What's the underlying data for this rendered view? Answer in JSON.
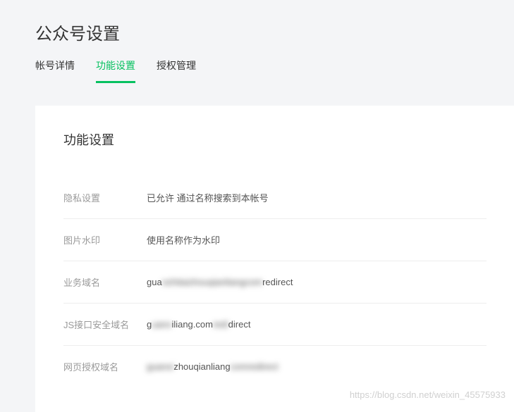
{
  "pageTitle": "公众号设置",
  "tabs": [
    {
      "label": "帐号详情",
      "active": false
    },
    {
      "label": "功能设置",
      "active": true
    },
    {
      "label": "授权管理",
      "active": false
    }
  ],
  "card": {
    "title": "功能设置",
    "rows": {
      "privacy": {
        "label": "隐私设置",
        "value": "已允许 通过名称搜索到本帐号"
      },
      "watermark": {
        "label": "图片水印",
        "value": "使用名称作为水印"
      },
      "businessDomain": {
        "label": "业务域名",
        "valuePrefix": "gua",
        "valueBlurred": "nzhitaizhouqianliangcom",
        "valueSuffix": "redirect"
      },
      "jsDomain": {
        "label": "JS接口安全域名",
        "valuePrefix": "g",
        "valueBlurred1": "uanx",
        "valueMid": "iliang.com",
        "valueBlurred2": "redi",
        "valueSuffix": "direct"
      },
      "oauthDomain": {
        "label": "网页授权域名",
        "valueBlurred1": "guanxi",
        "valueMid": "zhouqianliang",
        "valueBlurred2": "comredirect"
      }
    }
  },
  "footerWatermark": "https://blog.csdn.net/weixin_45575933"
}
